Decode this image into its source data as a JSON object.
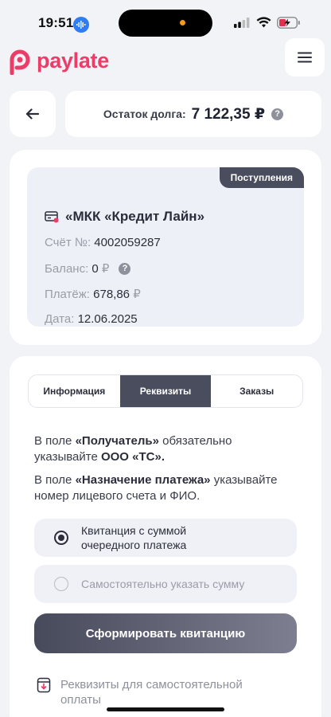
{
  "status_bar": {
    "time": "19:51",
    "icons": [
      "voice-memo-icon",
      "signal-icon",
      "wifi-icon",
      "battery-charging-icon"
    ]
  },
  "header": {
    "logo_text": "paylate",
    "brand_color": "#ec3d68",
    "menu_icon": "hamburger-menu-icon"
  },
  "summary": {
    "back_icon": "arrow-left-icon",
    "debt_label": "Остаток долга:",
    "debt_value": "7 122,35 ₽",
    "help_icon": "question-mark-icon",
    "help_glyph": "?"
  },
  "loan": {
    "badge": "Поступления",
    "lender_icon": "credit-card-icon",
    "lender": "«МКК «Кредит Лайн»",
    "account_label": "Счёт №:",
    "account_value": "4002059287",
    "balance_label": "Баланс:",
    "balance_value": "0",
    "balance_currency": "₽",
    "payment_label": "Платёж:",
    "payment_value": "678,86",
    "payment_currency": "₽",
    "date_label": "Дата:",
    "date_value": "12.06.2025"
  },
  "tabs": [
    {
      "label": "Информация",
      "active": false
    },
    {
      "label": "Реквизиты",
      "active": true
    },
    {
      "label": "Заказы",
      "active": false
    }
  ],
  "details": {
    "p1_prefix": "В поле ",
    "p1_field": "«Получатель»",
    "p1_middle": " обязательно указывайте ",
    "p1_org": "ООО «ТС».",
    "p2_prefix": "В поле ",
    "p2_field": "«Назначение платежа»",
    "p2_suffix": " указывайте номер лицевого счета и ФИО.",
    "option1": "Квитанция с суммой очередного платежа",
    "option1_selected": true,
    "option2": "Самостоятельно указать сумму",
    "option2_selected": false,
    "submit_label": "Сформировать квитанцию",
    "link_icon": "download-document-icon",
    "link_text": "Реквизиты для самостоятельной оплаты"
  }
}
